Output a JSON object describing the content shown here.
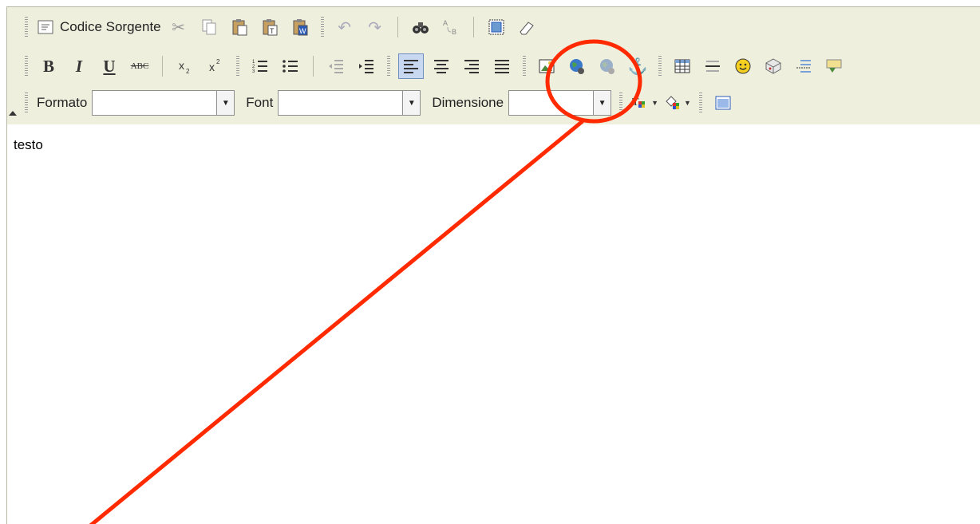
{
  "toolbar": {
    "source_label": "Codice Sorgente",
    "bold_label": "B",
    "italic_label": "I",
    "underline_label": "U",
    "strike_label": "ABC",
    "format_label": "Formato",
    "font_label": "Font",
    "size_label": "Dimensione",
    "format_value": "",
    "font_value": "",
    "size_value": ""
  },
  "editor": {
    "content_text": "testo"
  },
  "colors": {
    "toolbar_bg": "#efefde",
    "annotation": "#ff2a00",
    "active_button": "#c8d8f0"
  }
}
